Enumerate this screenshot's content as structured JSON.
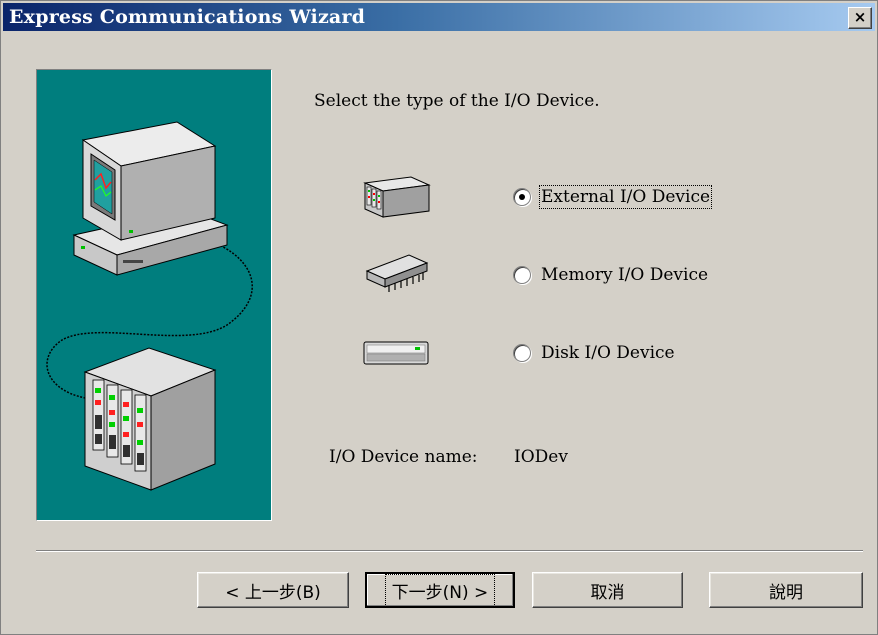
{
  "window": {
    "title": "Express Communications Wizard",
    "close_label": "×"
  },
  "main": {
    "instruction": "Select the type of the I/O Device.",
    "options": [
      {
        "label": "External I/O Device",
        "selected": true,
        "icon": "io-module-icon"
      },
      {
        "label": "Memory I/O Device",
        "selected": false,
        "icon": "memory-chip-icon"
      },
      {
        "label": "Disk I/O Device",
        "selected": false,
        "icon": "disk-drive-icon"
      }
    ],
    "device_name_label": "I/O Device name:",
    "device_name_value": "IODev"
  },
  "buttons": {
    "back": "< 上一步(B)",
    "next": "下一步(N) >",
    "cancel": "取消",
    "help": "說明"
  },
  "colors": {
    "title_start": "#0a246a",
    "title_end": "#a6caf0",
    "illustration_bg": "#007e7e",
    "dialog_bg": "#d4d0c8"
  }
}
